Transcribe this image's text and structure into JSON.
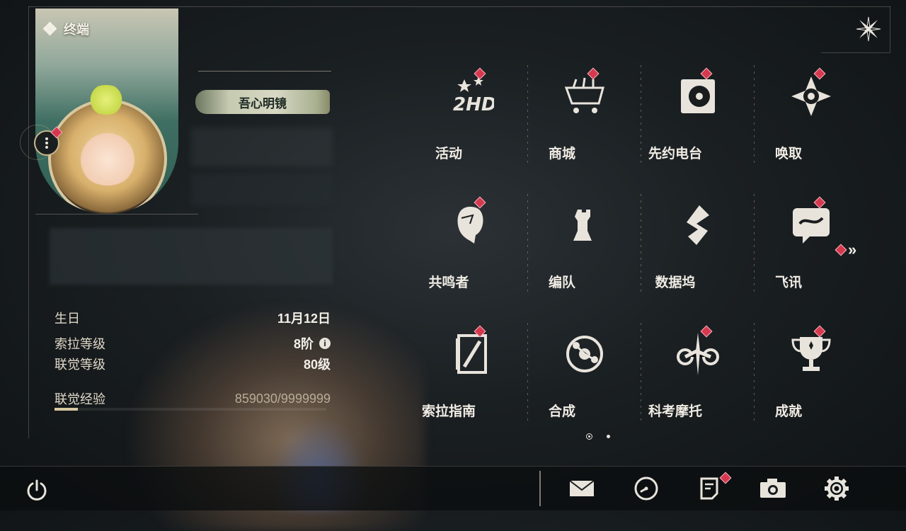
{
  "header": {
    "terminal_label": "终端"
  },
  "profile": {
    "title_badge": "吾心明镜"
  },
  "stats": {
    "birthday_label": "生日",
    "birthday_value": "11月12日",
    "sola_level_label": "索拉等级",
    "sola_level_value": "8阶",
    "union_level_label": "联觉等级",
    "union_level_value": "80级",
    "union_exp_label": "联觉经验",
    "union_exp_value": "859030/9999999",
    "union_exp_progress": 0.086,
    "info_glyph": "i"
  },
  "menu": {
    "items": [
      {
        "label": "活动",
        "icon": "event-icon",
        "badge": true
      },
      {
        "label": "商城",
        "icon": "shop-icon",
        "badge": true
      },
      {
        "label": "先约电台",
        "icon": "radio-icon",
        "badge": true
      },
      {
        "label": "唤取",
        "icon": "convene-icon",
        "badge": true
      },
      {
        "label": "共鸣者",
        "icon": "resonator-icon",
        "badge": true
      },
      {
        "label": "编队",
        "icon": "team-icon",
        "badge": false
      },
      {
        "label": "数据坞",
        "icon": "data-bank-icon",
        "badge": false
      },
      {
        "label": "飞讯",
        "icon": "message-icon",
        "badge": true
      },
      {
        "label": "索拉指南",
        "icon": "guidebook-icon",
        "badge": true
      },
      {
        "label": "合成",
        "icon": "synthesis-icon",
        "badge": false
      },
      {
        "label": "科考摩托",
        "icon": "motorbike-icon",
        "badge": true
      },
      {
        "label": "成就",
        "icon": "trophy-icon",
        "badge": true
      }
    ],
    "next_glyph": "»"
  },
  "bottom_bar": {
    "buttons": [
      "power-icon",
      "mail-icon",
      "clock-icon",
      "notice-icon",
      "camera-icon",
      "settings-icon"
    ]
  },
  "colors": {
    "accent": "#d8c8a0",
    "badge": "#d6394f",
    "text": "#f0ece4"
  }
}
